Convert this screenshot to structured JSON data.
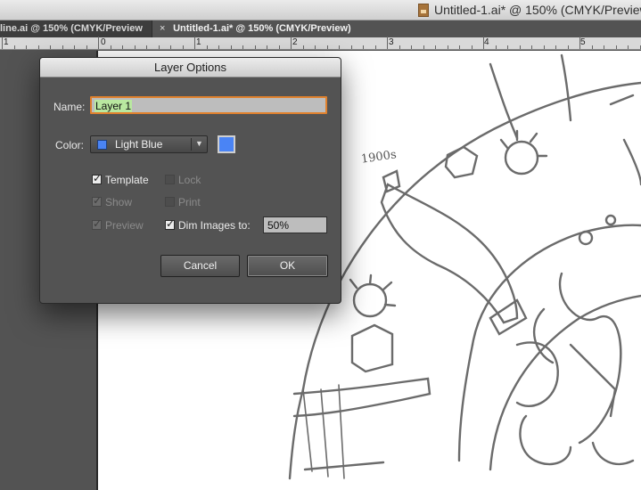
{
  "window": {
    "title": "Untitled-1.ai* @ 150% (CMYK/Preview",
    "file_icon": "illustrator-file-icon"
  },
  "tabs": [
    {
      "label": "line.ai @ 150% (CMYK/Preview",
      "active": false
    },
    {
      "close": "×",
      "label": "Untitled-1.ai* @ 150% (CMYK/Preview)",
      "active": true
    }
  ],
  "ruler": {
    "labels": [
      "1",
      "0",
      "1",
      "2",
      "3",
      "4",
      "5"
    ]
  },
  "artwork": {
    "note": "1900s"
  },
  "dialog": {
    "title": "Layer Options",
    "name_label": "Name:",
    "name_value": "Layer 1",
    "color_label": "Color:",
    "color_value": "Light Blue",
    "color_hex": "#4a84f5",
    "options": {
      "template": {
        "label": "Template",
        "checked": true
      },
      "lock": {
        "label": "Lock",
        "checked": false
      },
      "show": {
        "label": "Show",
        "checked": true
      },
      "print": {
        "label": "Print",
        "checked": false
      },
      "preview": {
        "label": "Preview",
        "checked": true
      },
      "dim_images": {
        "label": "Dim Images to:",
        "checked": true,
        "value": "50%"
      }
    },
    "cancel_label": "Cancel",
    "ok_label": "OK"
  }
}
